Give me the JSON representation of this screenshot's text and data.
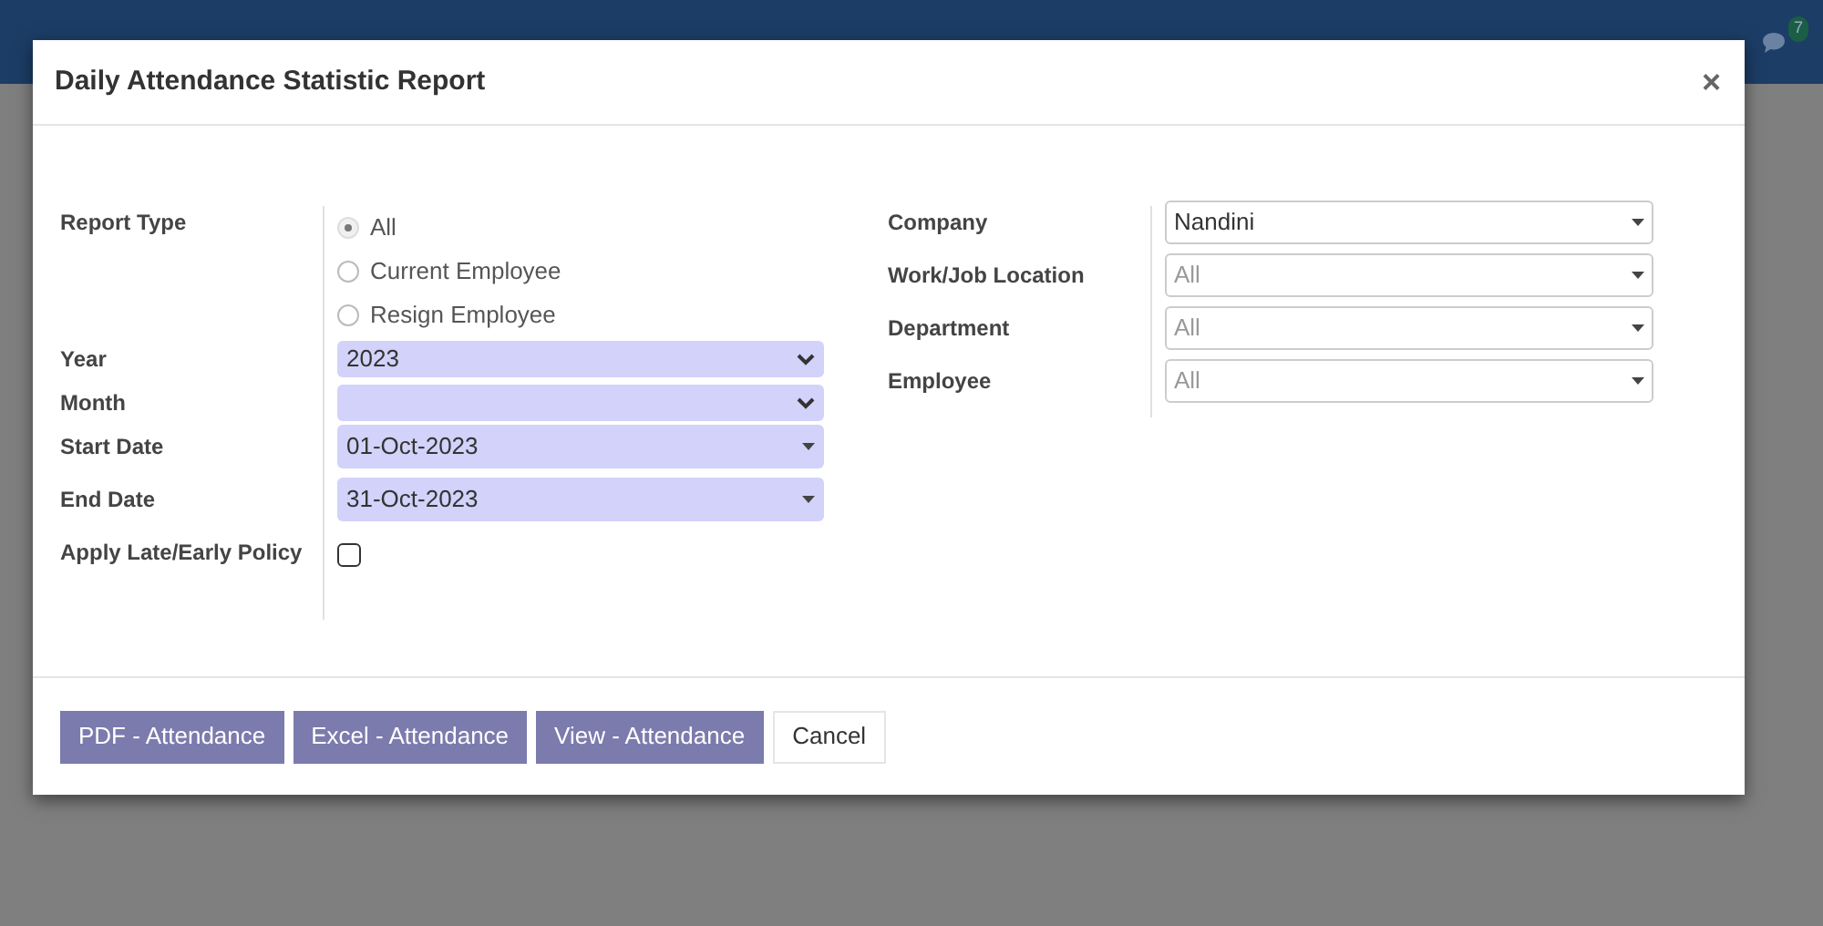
{
  "navbar": {
    "chat_count": "7"
  },
  "dialog": {
    "title": "Daily Attendance Statistic Report",
    "close": "×",
    "left_fields": [
      {
        "label": "Report Type",
        "kind": "radio",
        "options": [
          {
            "label": "All",
            "selected": true
          },
          {
            "label": "Current Employee",
            "selected": false
          },
          {
            "label": "Resign Employee",
            "selected": false
          }
        ]
      },
      {
        "label": "Year",
        "kind": "select",
        "value": "2023"
      },
      {
        "label": "Month",
        "kind": "select"
      },
      {
        "label": "Start Date",
        "kind": "date",
        "value": "01-Oct-2023"
      },
      {
        "label": "End Date",
        "kind": "date",
        "value": "31-Oct-2023"
      },
      {
        "label": "Apply Late/Early Policy",
        "kind": "checkbox",
        "checked": false
      }
    ],
    "right_fields": [
      {
        "label": "Company",
        "value": "Nandini"
      },
      {
        "label": "Work/Job Location",
        "placeholder": "All"
      },
      {
        "label": "Department",
        "placeholder": "All"
      },
      {
        "label": "Employee",
        "placeholder": "All"
      }
    ],
    "buttons": [
      {
        "label": "PDF - Attendance",
        "kind": "primary"
      },
      {
        "label": "Excel - Attendance",
        "kind": "primary"
      },
      {
        "label": "View - Attendance",
        "kind": "primary"
      },
      {
        "label": "Cancel",
        "kind": "secondary"
      }
    ]
  }
}
